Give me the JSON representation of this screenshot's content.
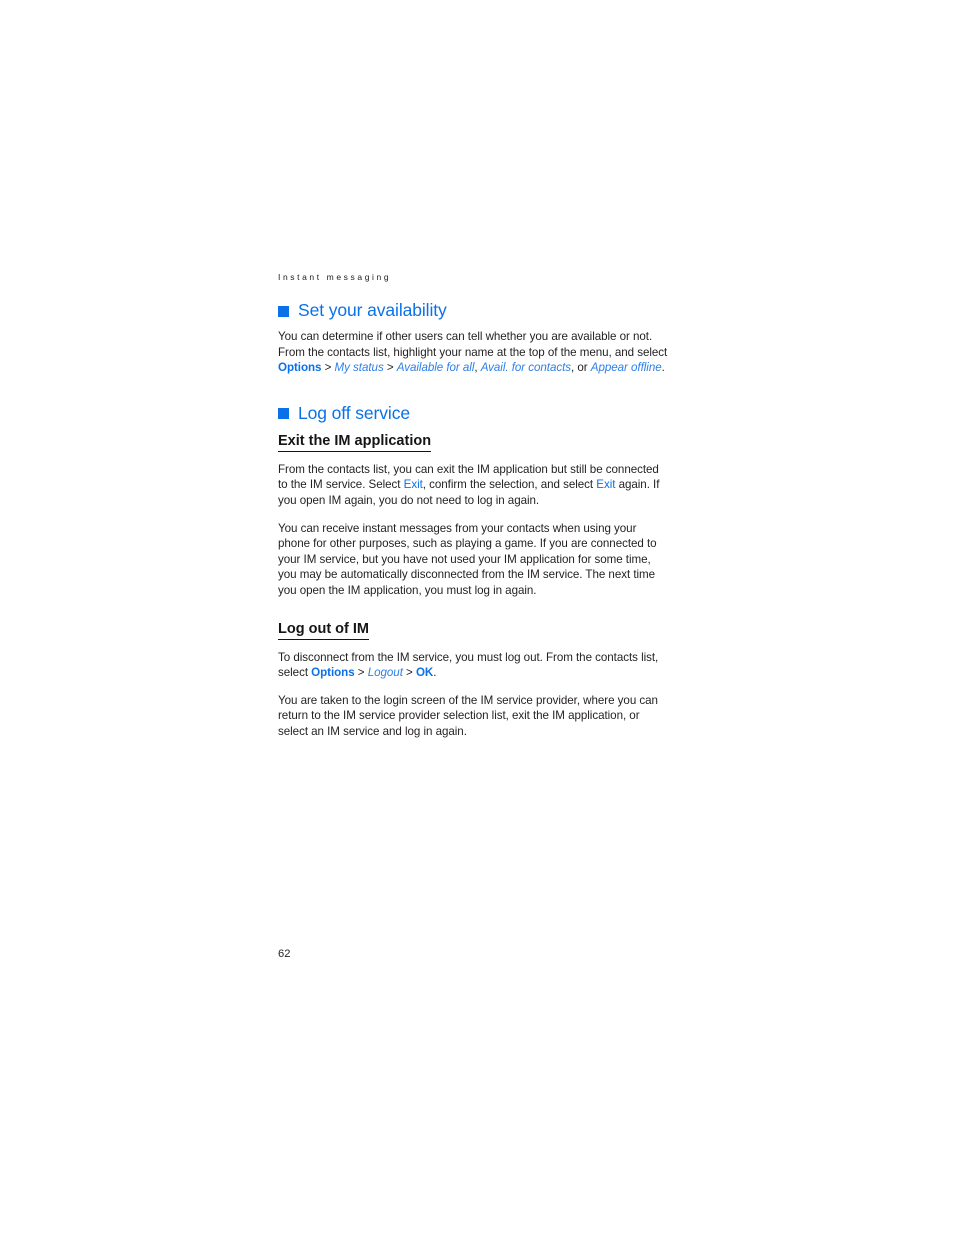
{
  "page": {
    "running_head": "Instant messaging",
    "folio": "62",
    "accent_color": "#0a71e8",
    "text_color": "#231f20"
  },
  "sections": [
    {
      "heading": "Set your availability",
      "bullet_icon": "square-bullet-icon",
      "paragraphs": [
        {
          "runs": [
            {
              "text": "You can determine if other users can tell whether you are available or not. From the contacts list, highlight your name at the top of the menu, and select ",
              "style": "plain"
            },
            {
              "text": "Options",
              "style": "ui-bold"
            },
            {
              "text": " > ",
              "style": "sep"
            },
            {
              "text": "My status",
              "style": "ui-italic"
            },
            {
              "text": " > ",
              "style": "sep"
            },
            {
              "text": "Available for all",
              "style": "ui-italic"
            },
            {
              "text": ", ",
              "style": "sep"
            },
            {
              "text": "Avail. for contacts",
              "style": "ui-italic"
            },
            {
              "text": ", or ",
              "style": "sep"
            },
            {
              "text": "Appear offline",
              "style": "ui-italic"
            },
            {
              "text": ".",
              "style": "sep"
            }
          ]
        }
      ]
    },
    {
      "heading": "Log off service",
      "bullet_icon": "square-bullet-icon",
      "subsections": [
        {
          "heading": "Exit the IM application",
          "paragraphs": [
            {
              "runs": [
                {
                  "text": "From the contacts list, you can exit the IM application but still be connected to the IM service. Select ",
                  "style": "plain"
                },
                {
                  "text": "Exit",
                  "style": "ui-plain"
                },
                {
                  "text": ", confirm the selection, and select ",
                  "style": "plain"
                },
                {
                  "text": "Exit",
                  "style": "ui-plain"
                },
                {
                  "text": " again. If you open IM again, you do not need to log in again.",
                  "style": "plain"
                }
              ]
            },
            {
              "runs": [
                {
                  "text": "You can receive instant messages from your contacts when using your phone for other purposes, such as playing a game. If you are connected to your IM service, but you have not used your IM application for some time, you may be automatically disconnected from the IM service. The next time you open the IM application, you must log in again.",
                  "style": "plain"
                }
              ]
            }
          ]
        },
        {
          "heading": "Log out of IM",
          "paragraphs": [
            {
              "runs": [
                {
                  "text": "To disconnect from the IM service, you must log out. From the contacts list, select ",
                  "style": "plain"
                },
                {
                  "text": "Options",
                  "style": "ui-bold"
                },
                {
                  "text": " > ",
                  "style": "sep"
                },
                {
                  "text": "Logout",
                  "style": "ui-italic"
                },
                {
                  "text": " > ",
                  "style": "sep"
                },
                {
                  "text": "OK",
                  "style": "ui-bold"
                },
                {
                  "text": ".",
                  "style": "sep"
                }
              ]
            },
            {
              "runs": [
                {
                  "text": "You are taken to the login screen of the IM service provider, where you can return to the IM service provider selection list, exit the IM application, or select an IM service and log in again.",
                  "style": "plain"
                }
              ]
            }
          ]
        }
      ]
    }
  ]
}
